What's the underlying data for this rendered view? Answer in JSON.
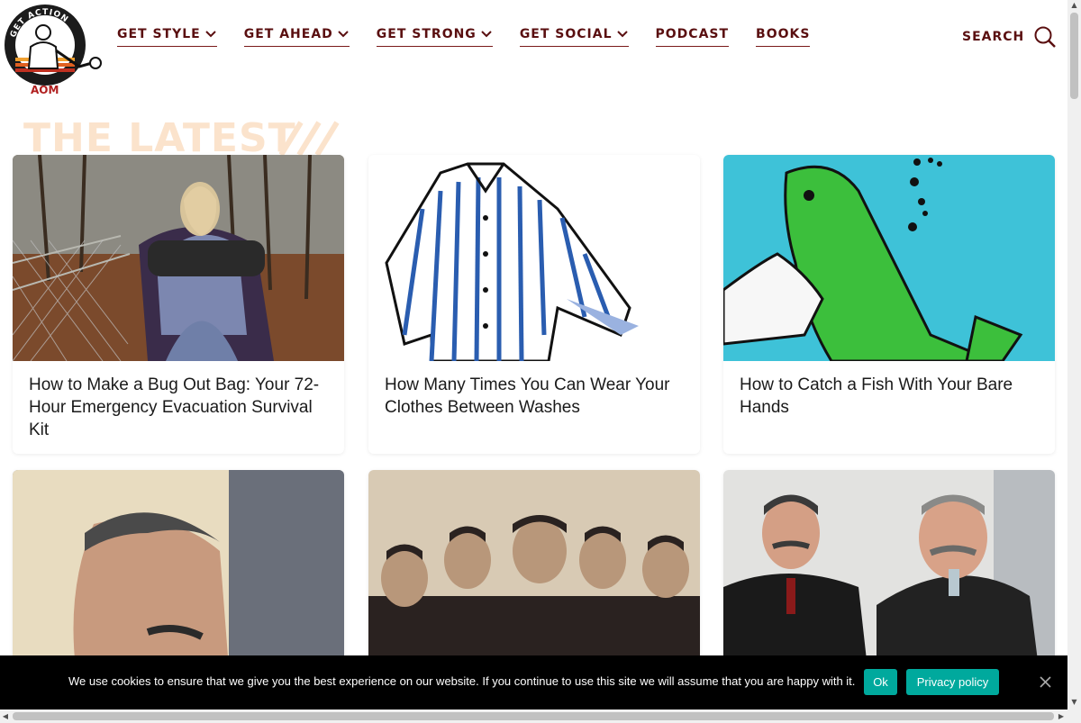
{
  "logo": {
    "ring_text": "GET ACTION",
    "brand": "AOM"
  },
  "nav": {
    "items": [
      {
        "label": "GET STYLE",
        "has_dropdown": true
      },
      {
        "label": "GET AHEAD",
        "has_dropdown": true
      },
      {
        "label": "GET STRONG",
        "has_dropdown": true
      },
      {
        "label": "GET SOCIAL",
        "has_dropdown": true
      },
      {
        "label": "PODCAST",
        "has_dropdown": false
      },
      {
        "label": "BOOKS",
        "has_dropdown": false
      }
    ],
    "search_label": "SEARCH"
  },
  "section": {
    "heading": "THE LATEST"
  },
  "articles": [
    {
      "title": "How to Make a Bug Out Bag: Your 72-Hour Emergency Evacuation Survival Kit"
    },
    {
      "title": "How Many Times You Can Wear Your Clothes Between Washes"
    },
    {
      "title": "How to Catch a Fish With Your Bare Hands"
    },
    {
      "title": ""
    },
    {
      "title": ""
    },
    {
      "title": ""
    }
  ],
  "cookie": {
    "message": "We use cookies to ensure that we give you the best experience on our website. If you continue to use this site we will assume that you are happy with it.",
    "ok_label": "Ok",
    "privacy_label": "Privacy policy"
  },
  "colors": {
    "brand": "#5a0f10",
    "accent": "#00a99d",
    "heading_faded": "#fbe3cc"
  }
}
